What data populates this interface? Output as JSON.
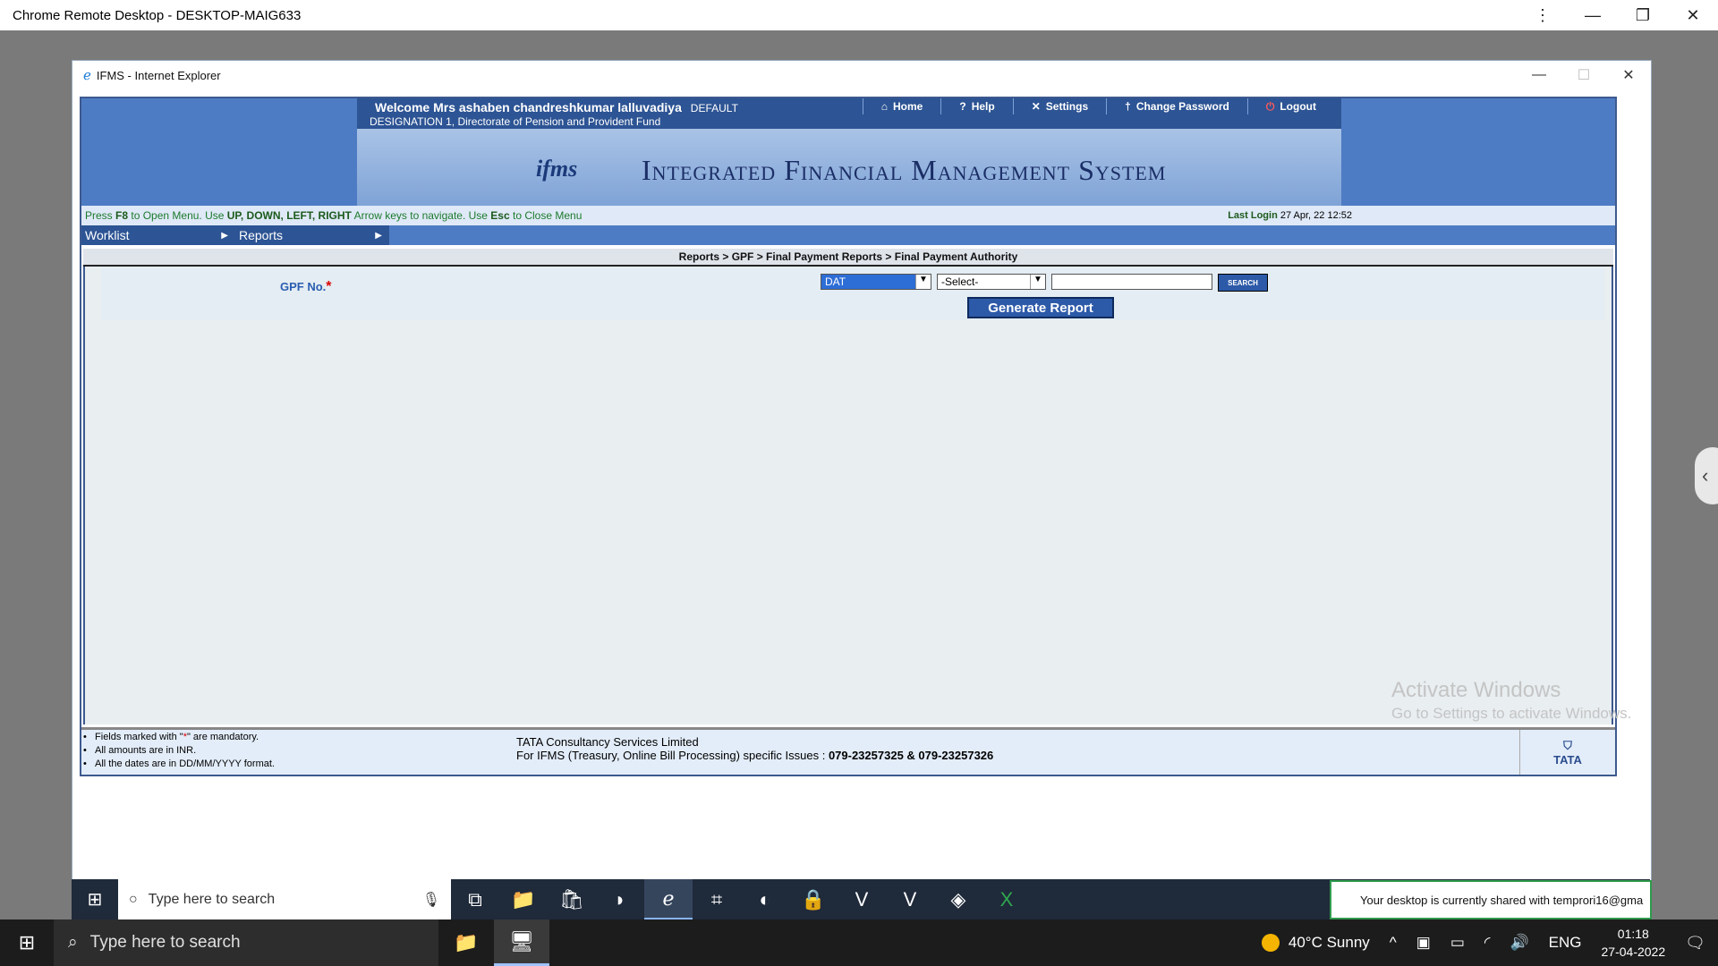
{
  "remote": {
    "title": "Chrome Remote Desktop - DESKTOP-MAIG633"
  },
  "ie": {
    "title": "IFMS - Internet Explorer"
  },
  "header": {
    "welcome": "Welcome Mrs ashaben chandreshkumar lalluvadiya",
    "role": "DEFAULT",
    "designation": "DESIGNATION 1, Directorate of Pension and Provident Fund",
    "nav": [
      {
        "icon": "home-icon",
        "label": "Home"
      },
      {
        "icon": "help-icon",
        "label": "Help"
      },
      {
        "icon": "settings-icon",
        "label": "Settings"
      },
      {
        "icon": "key-icon",
        "label": "Change Password"
      },
      {
        "icon": "logout-icon",
        "label": "Logout"
      }
    ],
    "logo": "ifms",
    "system_name": "Integrated Financial Management System"
  },
  "hint": {
    "pre1": "Press ",
    "key1": "F8",
    "pre2": " to Open Menu. Use ",
    "key2": "UP, DOWN, LEFT, RIGHT",
    "pre3": " Arrow keys to navigate. Use ",
    "key3": "Esc",
    "pre4": " to Close Menu",
    "last_login_label": "Last Login",
    "last_login_value": "27 Apr, 22 12:52"
  },
  "menu": [
    {
      "label": "Worklist"
    },
    {
      "label": "Reports"
    }
  ],
  "breadcrumb": "Reports > GPF > Final Payment Reports > Final Payment Authority",
  "form": {
    "gpf_label": "GPF No.",
    "required_mark": "*",
    "series_value": "DAT",
    "select_value": "-Select-",
    "gpf_input_value": "",
    "search_label": "SEARCH",
    "generate_label": "Generate Report"
  },
  "footer": {
    "note1_pre": "Fields marked with \"",
    "note1_mark": "*",
    "note1_post": "\" are mandatory.",
    "note2": "All amounts are in INR.",
    "note3": "All the dates are in DD/MM/YYYY format.",
    "company": "TATA Consultancy Services Limited",
    "support_pre": "For IFMS (Treasury, Online Bill Processing) specific Issues : ",
    "support_phones": "079-23257325 & 079-23257326",
    "brand": "TATA"
  },
  "activation": {
    "title": "Activate Windows",
    "subtitle": "Go to Settings to activate Windows."
  },
  "remote_taskbar": {
    "search_placeholder": "Type here to search"
  },
  "share_notice": "Your desktop is currently shared with temprori16@gma",
  "taskbar": {
    "search_placeholder": "Type here to search",
    "weather": "40°C  Sunny",
    "language": "ENG",
    "time": "01:18",
    "date": "27-04-2022"
  }
}
